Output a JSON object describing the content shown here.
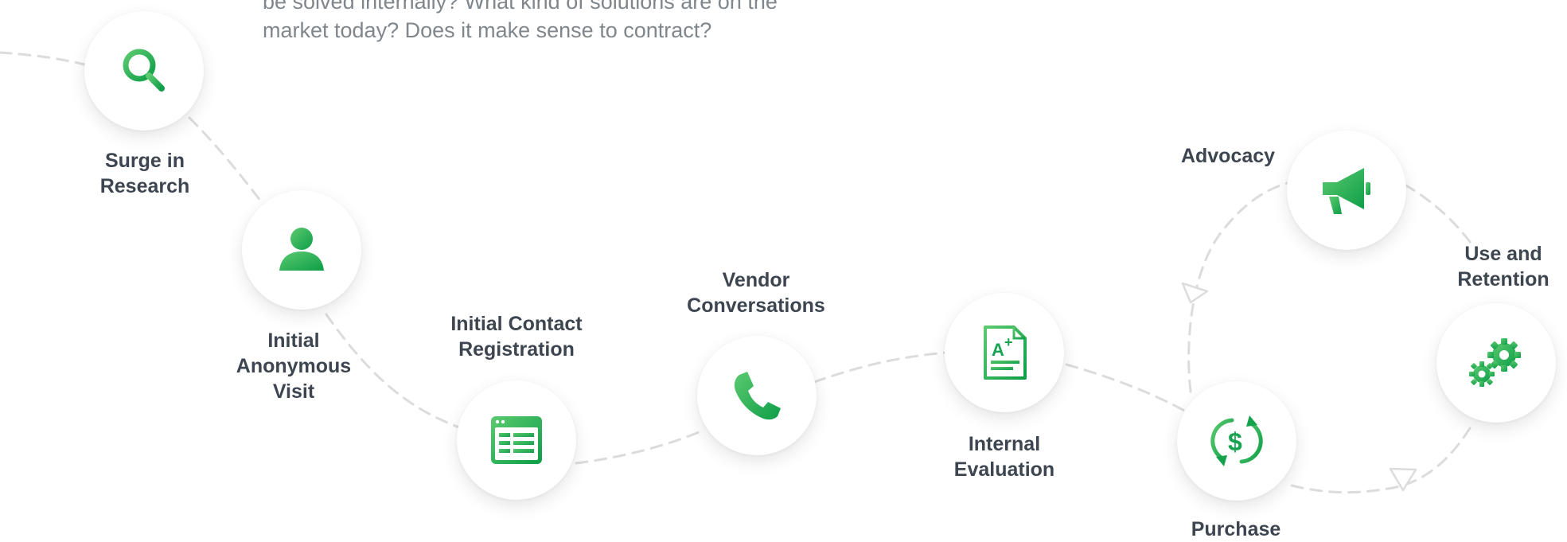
{
  "description": {
    "line1": "be solved internally? What kind of solutions are on the",
    "line2": "market today? Does it make sense to contract?"
  },
  "colors": {
    "accent_light": "#53c66a",
    "accent_dark": "#0fa14a",
    "label_text": "#3d4650",
    "body_text": "#7f878d",
    "path_dash": "#dcdcdc"
  },
  "stages": {
    "surge_in_research": {
      "line1": "Surge in",
      "line2": "Research",
      "icon": "search-icon"
    },
    "initial_anonymous_visit": {
      "line1": "Initial",
      "line2": "Anonymous",
      "line3": "Visit",
      "icon": "person-icon"
    },
    "initial_contact_registration": {
      "line1": "Initial Contact",
      "line2": "Registration",
      "icon": "form-icon"
    },
    "vendor_conversations": {
      "line1": "Vendor",
      "line2": "Conversations",
      "icon": "phone-icon"
    },
    "internal_evaluation": {
      "line1": "Internal",
      "line2": "Evaluation",
      "icon": "document-grade-icon"
    },
    "purchase": {
      "line1": "Purchase",
      "icon": "dollar-cycle-icon"
    },
    "use_and_retention": {
      "line1": "Use and",
      "line2": "Retention",
      "icon": "gears-icon"
    },
    "advocacy": {
      "line1": "Advocacy",
      "icon": "megaphone-icon"
    }
  }
}
